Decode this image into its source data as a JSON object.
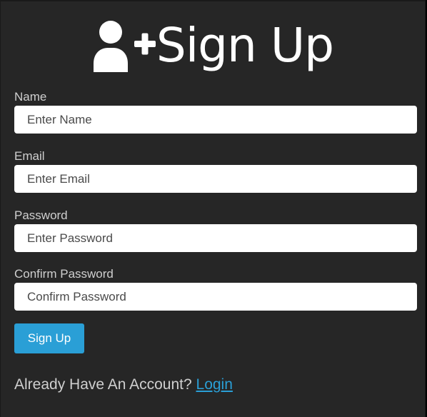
{
  "header": {
    "title": "Sign Up",
    "icon": "user-plus-icon"
  },
  "form": {
    "name": {
      "label": "Name",
      "placeholder": "Enter Name",
      "value": ""
    },
    "email": {
      "label": "Email",
      "placeholder": "Enter Email",
      "value": ""
    },
    "password": {
      "label": "Password",
      "placeholder": "Enter Password",
      "value": ""
    },
    "confirm_password": {
      "label": "Confirm Password",
      "placeholder": "Confirm Password",
      "value": ""
    },
    "submit_label": "Sign Up"
  },
  "footer": {
    "prompt": "Already Have An Account?",
    "link_label": "Login"
  },
  "colors": {
    "background": "#262626",
    "input_background": "#ffffff",
    "accent": "#2a9fd6",
    "label_text": "#cfcfcf",
    "title_text": "#ffffff"
  }
}
